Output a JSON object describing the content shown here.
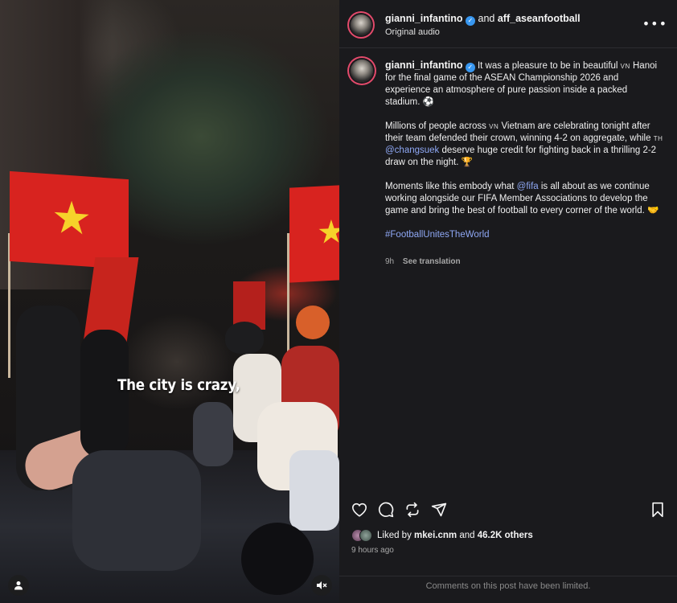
{
  "media": {
    "overlay_caption": "The city is crazy,",
    "profile_icon": "person-icon",
    "mute_icon": "speaker-muted-icon"
  },
  "header": {
    "author": "gianni_infantino",
    "joiner": "and",
    "coauthor": "aff_aseanfootball",
    "audio": "Original audio",
    "more_icon": "more-icon"
  },
  "caption": {
    "author": "gianni_infantino",
    "p1": "It was a pleasure to be in beautiful",
    "p1_flag": "VN",
    "p1_rest": "Hanoi for the final game of the ASEAN Championship 2026 and experience an atmosphere of pure passion inside a packed stadium.",
    "p1_emoji": "⚽",
    "p2a": "Millions of people across",
    "p2_flag": "VN",
    "p2b": "Vietnam are celebrating tonight after their team defended their crown, winning 4-2 on aggregate, while",
    "p2_flag2": "TH",
    "p2_mention": "@changsuek",
    "p2c": "deserve huge credit for fighting back in a thrilling 2-2 draw on the night.",
    "p2_emoji": "🏆",
    "p3a": "Moments like this embody what",
    "p3_mention": "@fifa",
    "p3b": "is all about as we continue working alongside our FIFA Member Associations to develop the game and bring the best of football to every corner of the world.",
    "p3_emoji": "🤝",
    "hashtag": "#FootballUnitesTheWorld",
    "age": "9h",
    "see_translation": "See translation"
  },
  "actions": {
    "like_icon": "heart-icon",
    "comment_icon": "comment-icon",
    "repost_icon": "repost-icon",
    "share_icon": "send-icon",
    "save_icon": "bookmark-icon"
  },
  "likes": {
    "prefix": "Liked by",
    "user": "mkei.cnm",
    "and": "and",
    "count": "46.2K others"
  },
  "timestamp": "9 hours ago",
  "comments_notice": "Comments on this post have been limited.",
  "colors": {
    "panel_bg": "#1a1a1d",
    "link": "#8fa8f5",
    "verified": "#3897f0",
    "flag_red": "#d8231f",
    "flag_star": "#f6d22a"
  }
}
